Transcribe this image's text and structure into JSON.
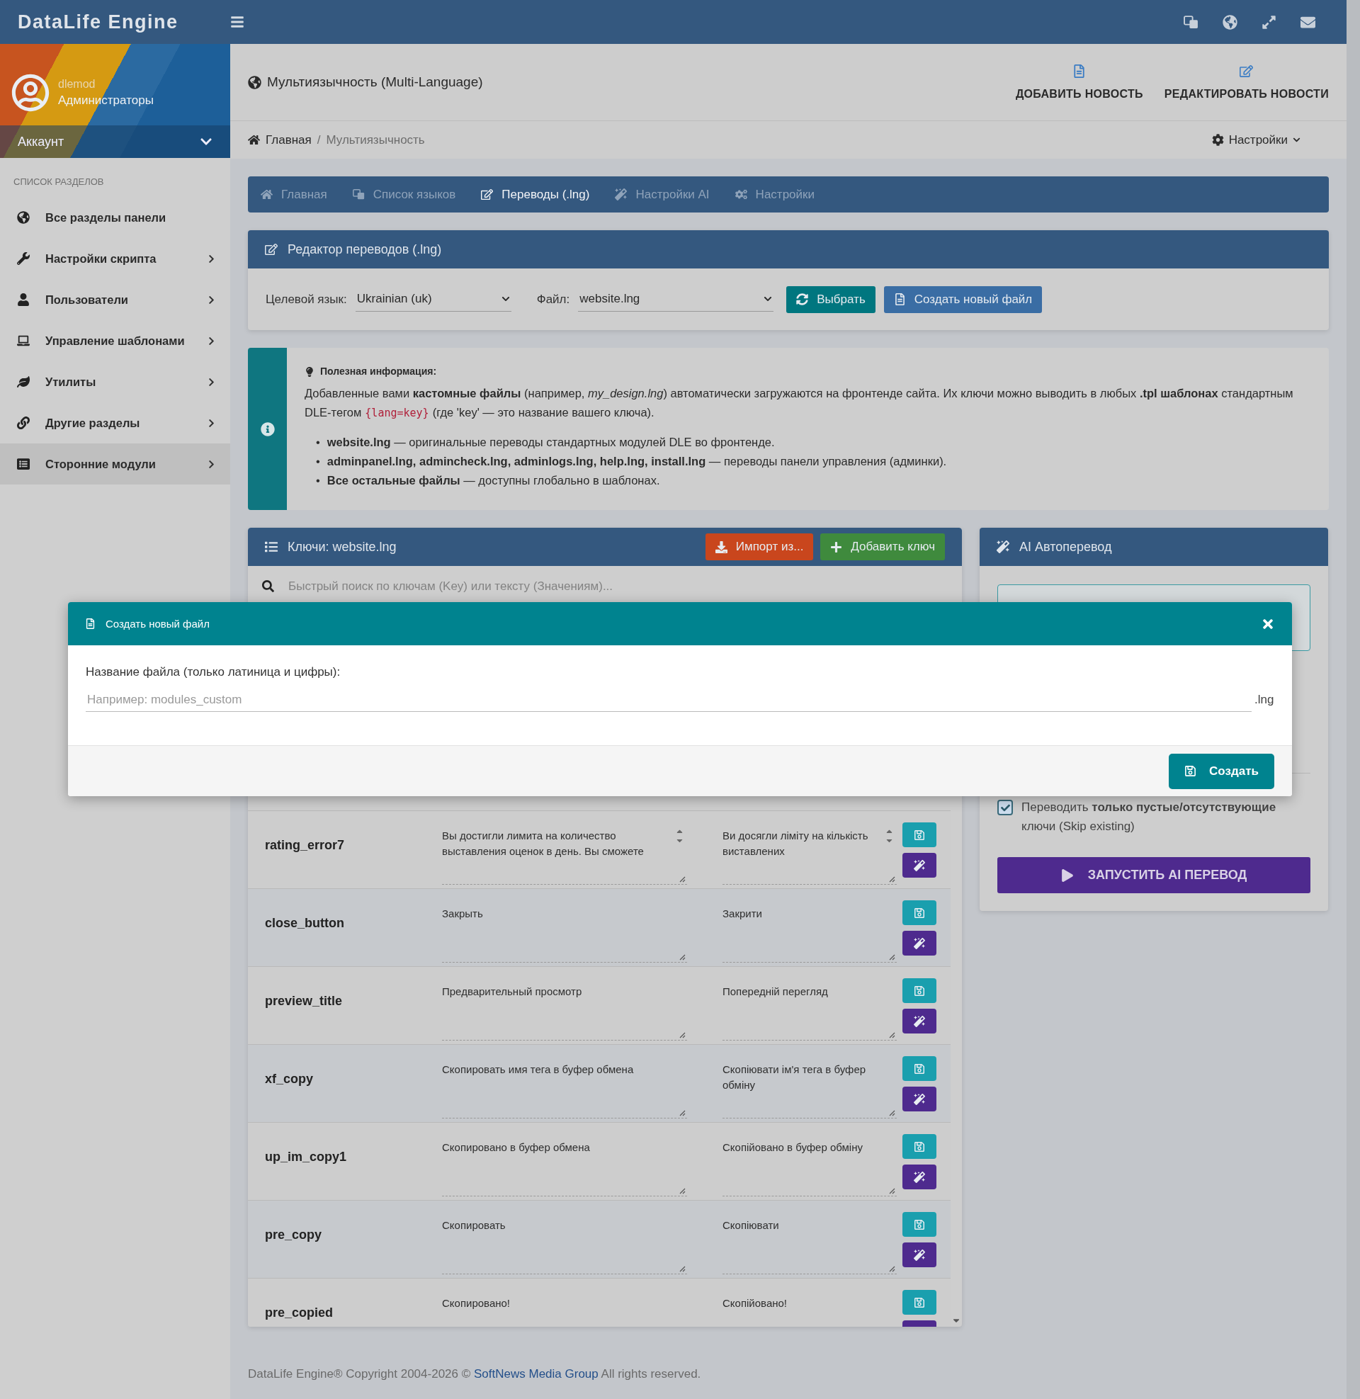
{
  "app": {
    "logo": "DataLife Engine"
  },
  "user": {
    "name": "dlemod",
    "group": "Администраторы",
    "account_label": "Аккаунт"
  },
  "sidebar": {
    "heading": "СПИСОК РАЗДЕЛОВ",
    "items": [
      {
        "label": "Все разделы панели",
        "has_submenu": false,
        "selected": false
      },
      {
        "label": "Настройки скрипта",
        "has_submenu": true,
        "selected": false
      },
      {
        "label": "Пользователи",
        "has_submenu": true,
        "selected": false
      },
      {
        "label": "Управление шаблонами",
        "has_submenu": true,
        "selected": false
      },
      {
        "label": "Утилиты",
        "has_submenu": true,
        "selected": false
      },
      {
        "label": "Другие разделы",
        "has_submenu": true,
        "selected": false
      },
      {
        "label": "Сторонние модули",
        "has_submenu": true,
        "selected": true
      }
    ]
  },
  "page_header": {
    "title": "Мультиязычность (Multi-Language)",
    "actions": [
      "ДОБАВИТЬ НОВОСТЬ",
      "РЕДАКТИРОВАТЬ НОВОСТИ"
    ]
  },
  "breadcrumb": {
    "items": [
      "Главная",
      "Мультиязычность"
    ],
    "separator": "/",
    "settings_label": "Настройки"
  },
  "tabs": [
    {
      "label": "Главная",
      "selected": false
    },
    {
      "label": "Список языков",
      "selected": false
    },
    {
      "label": "Переводы (.lng)",
      "selected": true
    },
    {
      "label": "Настройки AI",
      "selected": false
    },
    {
      "label": "Настройки",
      "selected": false
    }
  ],
  "editor": {
    "title": "Редактор переводов (.lng)",
    "language_label": "Целевой язык:",
    "language_value": "Ukrainian (uk)",
    "file_label": "Файл:",
    "file_value": "website.lng",
    "buttons": [
      {
        "label": "Выбрать",
        "kind": "select"
      },
      {
        "label": "Создать новый файл",
        "kind": "create"
      }
    ]
  },
  "info": {
    "title": "Полезная информация:",
    "text_before": "Добавленные вами **кастомные файлы** (например, *my_design.lng*) автоматически загружаются на фронтенде сайта. Их ключи можно выводить в любых **.tpl шаблонах** стандартным DLE-тегом",
    "code": "{lang=key}",
    "text_after": "(где 'key' — это название вашего ключа).",
    "bullet": "•",
    "list": [
      "**website.lng** — оригинальные переводы стандартных модулей DLE во фронтенде.",
      "**adminpanel.lng, admincheck.lng, adminlogs.lng, help.lng, install.lng** — переводы панели управления (админки).",
      "**Все остальные файлы** — доступны глобально в шаблонах."
    ]
  },
  "keys_panel": {
    "title": "Ключи: website.lng",
    "buttons": [
      {
        "label": "Импорт из...",
        "kind": "import"
      },
      {
        "label": "Добавить ключ",
        "kind": "add"
      }
    ],
    "search_placeholder": "Быстрый поиск по ключам (Key) или тексту (Значениям)...",
    "rows": [
      {
        "key": "rating_error7",
        "source": "Вы достигли лимита на количество выставления оценок в день. Вы сможете",
        "target": "Ви досягли ліміту на кількість виставлених",
        "overflowing": true
      },
      {
        "key": "close_button",
        "source": "Закрыть",
        "target": "Закрити",
        "overflowing": false
      },
      {
        "key": "preview_title",
        "source": "Предварительный просмотр",
        "target": "Попередній перегляд",
        "overflowing": false
      },
      {
        "key": "xf_copy",
        "source": "Скопировать имя тега в буфер обмена",
        "target": "Скопіювати ім'я тега в буфер обміну",
        "overflowing": false
      },
      {
        "key": "up_im_copy1",
        "source": "Скопировано в буфер обмена",
        "target": "Скопійовано в буфер обміну",
        "overflowing": false
      },
      {
        "key": "pre_copy",
        "source": "Скопировать",
        "target": "Скопіювати",
        "overflowing": false
      },
      {
        "key": "pre_copied",
        "source": "Скопировано!",
        "target": "Скопійовано!",
        "overflowing": false
      }
    ]
  },
  "ai_panel": {
    "title": "AI Автоперевод",
    "skip_existing": {
      "checked": true,
      "label": "Переводить **только пустые/отсутствующие** ключи (Skip existing)"
    },
    "run_button": "ЗАПУСТИТЬ AI ПЕРЕВОД"
  },
  "modal": {
    "title": "Создать новый файл",
    "field_label": "Название файла (только латиница и цифры):",
    "placeholder": "Например: modules_custom",
    "suffix": ".lng",
    "submit": "Создать"
  },
  "footer": {
    "text_before": "DataLife Engine® Copyright 2004-2026 ©",
    "link": "SoftNews Media Group",
    "text_after": "All rights reserved."
  }
}
